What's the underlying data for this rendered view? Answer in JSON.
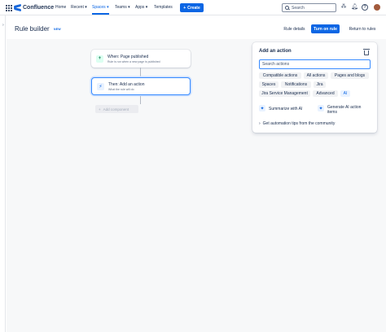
{
  "nav": {
    "app_name": "Confluence",
    "items": [
      {
        "label": "Home",
        "caret": ""
      },
      {
        "label": "Recent",
        "caret": "▾"
      },
      {
        "label": "Spaces",
        "caret": "▾"
      },
      {
        "label": "Teams",
        "caret": "▾"
      },
      {
        "label": "Apps",
        "caret": "▾"
      },
      {
        "label": "Templates",
        "caret": ""
      }
    ],
    "active_item": "Spaces",
    "create_label": "Create",
    "search_placeholder": "Search"
  },
  "header": {
    "title": "Rule builder",
    "badge": "NEW",
    "rule_details_label": "Rule details",
    "turn_on_label": "Turn on rule",
    "return_label": "Return to rules"
  },
  "flow": {
    "trigger": {
      "title": "When: Page published",
      "subtitle": "Rule is run when a new page is published"
    },
    "action": {
      "title": "Then: Add an action",
      "subtitle": "What the rule will do"
    },
    "add_component_label": "Add component"
  },
  "panel": {
    "title": "Add an action",
    "search_placeholder": "Search actions",
    "chips": [
      "Compatible actions",
      "All actions",
      "Pages and blogs",
      "Spaces",
      "Notifications",
      "Jira",
      "Jira Service Management",
      "Advanced",
      "AI"
    ],
    "selected_chip": "AI",
    "actions": [
      {
        "label": "Summarize with AI"
      },
      {
        "label": "Generate AI action items"
      }
    ],
    "tips_label": "Get automation tips from the community"
  },
  "colors": {
    "brand": "#0c66e4",
    "selection": "#388bff",
    "canvas_bg": "#f7f8f9",
    "trigger_icon_bg": "#dcfff1"
  },
  "icons": [
    "app-grid-icon",
    "confluence-logo-icon",
    "plus-icon",
    "search-icon",
    "apps-icon",
    "bell-icon",
    "help-icon",
    "chevron-right-icon",
    "bolt-icon",
    "trash-icon",
    "sparkle-icon",
    "chevron-right-icon"
  ]
}
